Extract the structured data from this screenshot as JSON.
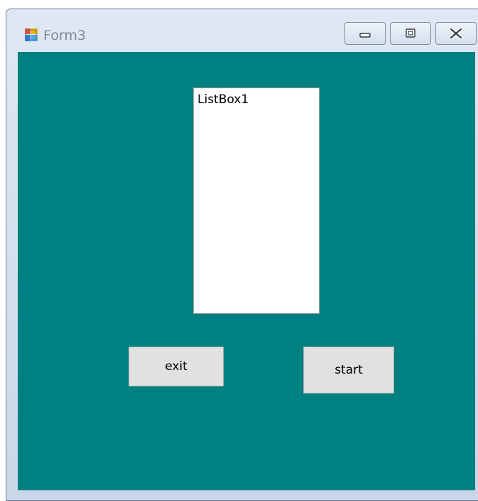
{
  "window": {
    "title": "Form3",
    "icon": "form-app-icon",
    "caption_buttons": [
      "minimize-icon",
      "maximize-icon",
      "close-icon"
    ],
    "client_background": "#008080"
  },
  "listbox": {
    "items": [
      "ListBox1"
    ]
  },
  "buttons": {
    "exit_label": "exit",
    "start_label": "start"
  }
}
